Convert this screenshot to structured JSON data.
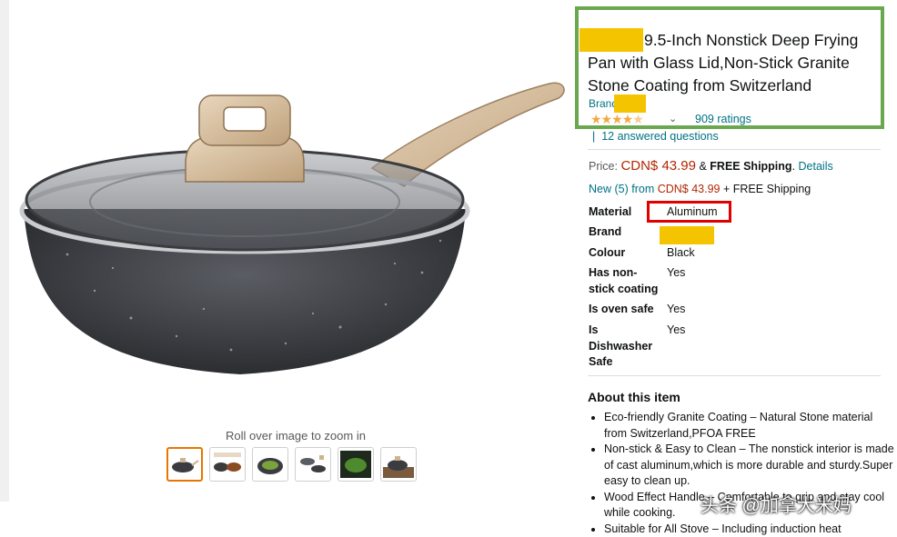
{
  "product": {
    "title": "9.5-Inch Nonstick Deep Frying Pan with Glass Lid,Non-Stick Granite Stone Coating from Switzerland",
    "brand_link": "Brand",
    "ratings": "909 ratings",
    "rating_stars": 4.5,
    "answered_questions": "12 answered questions",
    "image_alt_hint": "Roll over image to zoom in",
    "thumbnail_count": 6
  },
  "price": {
    "label": "Price:",
    "value": "CDN$ 43.99",
    "shipping_prefix": "& ",
    "shipping": "FREE Shipping",
    "details": "Details"
  },
  "offers": {
    "new_label": "New (5) from",
    "new_price": "CDN$ 43.99",
    "new_shipping": "+ FREE Shipping"
  },
  "specs": [
    {
      "label": "Material",
      "value": "Aluminum"
    },
    {
      "label": "Brand",
      "value": ""
    },
    {
      "label": "Colour",
      "value": "Black"
    },
    {
      "label": "Has non-stick coating",
      "value": "Yes"
    },
    {
      "label": "Is oven safe",
      "value": "Yes"
    },
    {
      "label": "Is Dishwasher Safe",
      "value": "Yes"
    }
  ],
  "about": {
    "title": "About this item",
    "items": [
      "Eco-friendly Granite Coating – Natural Stone material from Switzerland,PFOA FREE",
      "Non-stick & Easy to Clean – The nonstick interior is made of cast aluminum,which is more durable and sturdy.Super easy to clean up.",
      "Wood Effect Handle – Comfortable to grip and stay cool while cooking.",
      "Suitable for All Stove – Including induction heat"
    ]
  },
  "watermark": "头条 @加拿大米妈",
  "colors": {
    "link": "#007185",
    "price": "#b12704",
    "highlight_green": "#6aa84f",
    "highlight_red": "#e00000",
    "redaction": "#f5c400",
    "star": "#f3a847"
  }
}
